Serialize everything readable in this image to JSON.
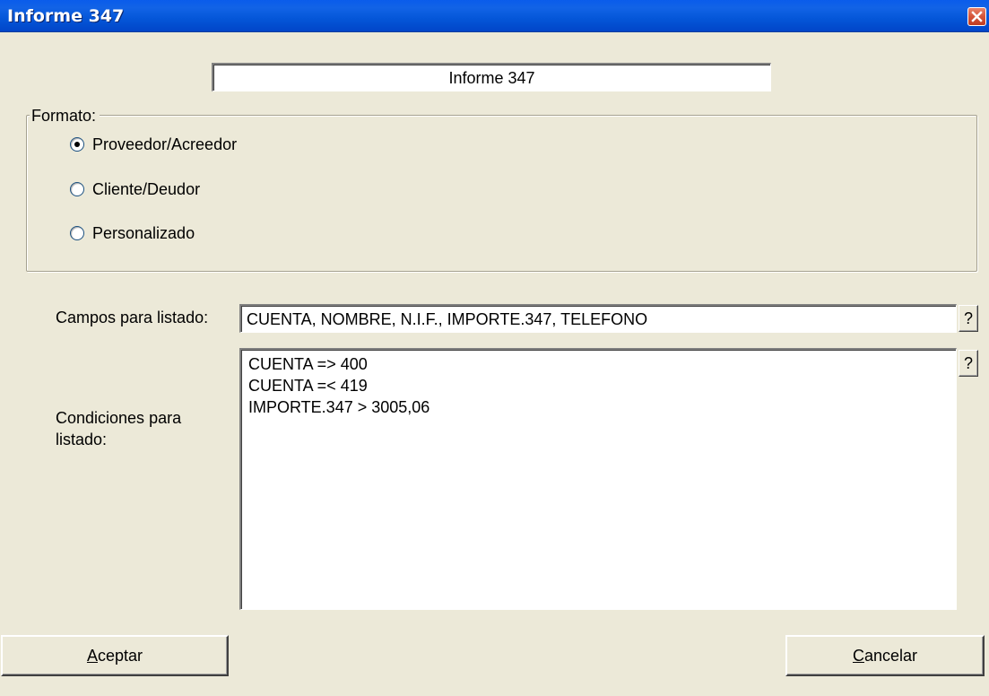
{
  "window": {
    "title": "Informe 347"
  },
  "report_name": "Informe 347",
  "format": {
    "legend": "Formato:",
    "options": [
      {
        "label": "Proveedor/Acreedor",
        "checked": true
      },
      {
        "label": "Cliente/Deudor",
        "checked": false
      },
      {
        "label": "Personalizado",
        "checked": false
      }
    ]
  },
  "fields": {
    "label": "Campos para listado:",
    "value": "CUENTA, NOMBRE, N.I.F., IMPORTE.347, TELEFONO",
    "help": "?"
  },
  "conditions": {
    "label_line1": "Condiciones para",
    "label_line2": "listado:",
    "lines": [
      "CUENTA => 400",
      "CUENTA =< 419",
      "IMPORTE.347 > 3005,06"
    ],
    "help": "?"
  },
  "buttons": {
    "accept_mnemonic": "A",
    "accept_rest": "ceptar",
    "cancel_mnemonic": "C",
    "cancel_rest": "ancelar"
  },
  "icons": {
    "close": "close-icon"
  },
  "colors": {
    "titlebar": "#0456D8",
    "dialog_bg": "#ECE9D8",
    "close_button": "#D5553A"
  }
}
